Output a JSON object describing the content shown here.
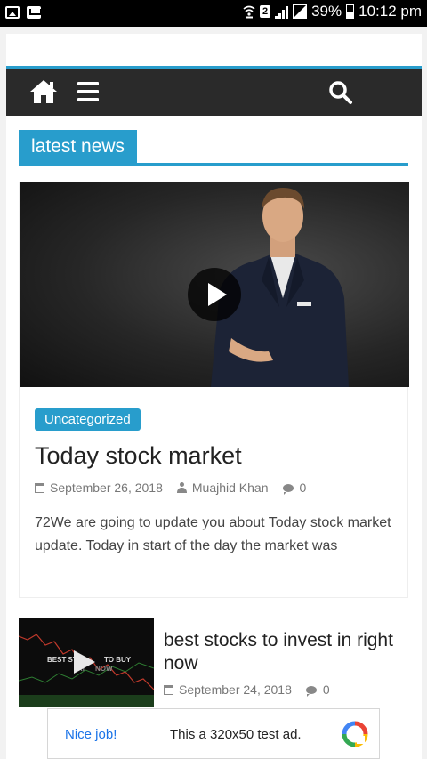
{
  "status_bar": {
    "left_icons": [
      "image-icon",
      "mail-icon"
    ],
    "sim": "2",
    "battery": "39%",
    "time": "10:12 pm"
  },
  "nav": {
    "icons": [
      "home-icon",
      "menu-icon",
      "search-icon"
    ],
    "background": "#2a2a2a",
    "accent": "#289dcc"
  },
  "section": {
    "title": "latest news"
  },
  "featured_post": {
    "category": "Uncategorized",
    "title": "Today stock market",
    "date": "September 26, 2018",
    "author": "Muajhid Khan",
    "comments": "0",
    "excerpt": "72We are going to update you about Today stock market update. Today in start of the day the market was"
  },
  "second_post": {
    "thumbnail_text": [
      "BEST ST",
      "TO BUY",
      "RI",
      "NOW"
    ],
    "title": "best stocks to invest in right now",
    "date": "September 24, 2018",
    "comments": "0"
  },
  "ad": {
    "label": "Nice job!",
    "text": "This a 320x50 test ad."
  }
}
